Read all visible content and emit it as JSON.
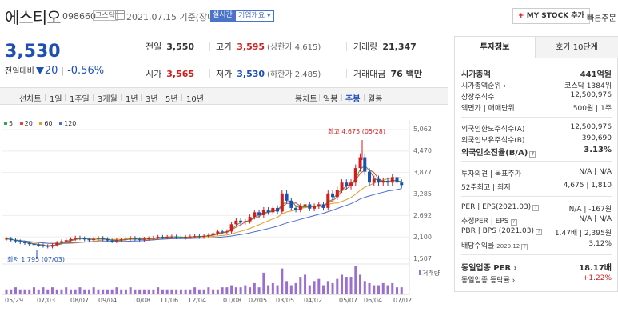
{
  "header": {
    "name": "에스티오",
    "code": "098660",
    "market": "코스닥",
    "date": "2021.07.15 기준(장마감)",
    "realtime": "실시간",
    "overview": "기업개요",
    "mystock": "MY STOCK 추가",
    "quick": "빠른주문"
  },
  "price": {
    "current": "3,530",
    "change_label": "전일대비",
    "change": "20",
    "change_pct": "-0.56%"
  },
  "quote": {
    "prev_label": "전일",
    "prev": "3,550",
    "high_label": "고가",
    "high": "3,595",
    "upper_limit": "(상한가 4,615)",
    "volume_label": "거래량",
    "volume": "21,347",
    "open_label": "시가",
    "open": "3,565",
    "low_label": "저가",
    "low": "3,530",
    "lower_limit": "(하한가 2,485)",
    "amount_label": "거래대금",
    "amount": "76 백만"
  },
  "tabs": {
    "line": "선차트",
    "d1": "1일",
    "w1": "1주일",
    "m3": "3개월",
    "y1": "1년",
    "y3": "3년",
    "y5": "5년",
    "y10": "10년",
    "candle": "봉차트",
    "daily": "일봉",
    "weekly": "주봉",
    "monthly": "월봉"
  },
  "legend": [
    {
      "label": "5",
      "color": "#2fa84a"
    },
    {
      "label": "20",
      "color": "#e8423a"
    },
    {
      "label": "60",
      "color": "#e39b2c"
    },
    {
      "label": "120",
      "color": "#4d6bd0"
    }
  ],
  "chart_data": {
    "type": "candlestick",
    "y_ticks": [
      "5,062",
      "4,470",
      "3,877",
      "3,285",
      "2,692",
      "2,100",
      "1,507"
    ],
    "ylim": [
      1507,
      5062
    ],
    "x_ticks": [
      "05/29",
      "07/03",
      "08/07",
      "09/04",
      "10/08",
      "11/06",
      "12/04",
      "01/08",
      "02/05",
      "03/05",
      "04/02",
      "05/07",
      "06/04",
      "07/02"
    ],
    "max_annotation": "최고 4,675 (05/28)",
    "min_annotation": "최저 1,795 (07/03)",
    "volume_label": "거래량",
    "weekly_closes": [
      2050,
      2010,
      1980,
      1950,
      1930,
      1900,
      1880,
      1870,
      1850,
      1830,
      1880,
      1940,
      1980,
      2010,
      2040,
      2080,
      2060,
      2030,
      2010,
      2050,
      2070,
      2040,
      2000,
      1980,
      2010,
      2030,
      2050,
      2070,
      2040,
      2020,
      2050,
      2060,
      2080,
      2100,
      2090,
      2100,
      2110,
      2090,
      2080,
      2100,
      2110,
      2120,
      2100,
      2130,
      2150,
      2200,
      2250,
      2230,
      2250,
      2450,
      2550,
      2500,
      2530,
      2650,
      2780,
      2700,
      2850,
      2780,
      2900,
      2800,
      3300,
      3100,
      2900,
      2850,
      2950,
      3000,
      2880,
      2950,
      3000,
      2900,
      3300,
      3200,
      3400,
      3600,
      3500,
      3600,
      4000,
      4300,
      3900,
      3600,
      3700,
      3600,
      3650,
      3600,
      3750,
      3600,
      3530
    ],
    "weekly_volumes": [
      2,
      2,
      3,
      2,
      2,
      2,
      3,
      2,
      3,
      2,
      3,
      2,
      2,
      3,
      2,
      2,
      3,
      2,
      2,
      3,
      2,
      2,
      2,
      2,
      3,
      2,
      2,
      3,
      2,
      2,
      2,
      2,
      2,
      3,
      2,
      2,
      2,
      2,
      2,
      2,
      2,
      3,
      2,
      2,
      3,
      2,
      2,
      3,
      3,
      4,
      3,
      3,
      4,
      3,
      5,
      3,
      10,
      4,
      5,
      4,
      12,
      6,
      4,
      5,
      8,
      9,
      4,
      6,
      7,
      4,
      6,
      5,
      7,
      9,
      8,
      8,
      13,
      9,
      6,
      5,
      4,
      4,
      5,
      4,
      5,
      3,
      3
    ]
  },
  "right_panel": {
    "tab_info": "투자정보",
    "tab_order": "호가 10단계",
    "market_cap_label": "시가총액",
    "market_cap": "441억원",
    "cap_rank_label": "시가총액순위",
    "cap_rank": "코스닥 1384위",
    "listed_label": "상장주식수",
    "listed": "12,500,976",
    "par_label": "액면가 | 매매단위",
    "par": "500원 | 1주",
    "foreign_limit_label": "외국인한도주식수(A)",
    "foreign_limit": "12,500,976",
    "foreign_hold_label": "외국인보유주식수(B)",
    "foreign_hold": "390,690",
    "foreign_ratio_label": "외국인소진율(B/A)",
    "foreign_ratio": "3.13%",
    "opinion_label": "투자의견 | 목표주가",
    "opinion": "N/A | N/A",
    "w52_label": "52주최고 | 최저",
    "w52": "4,675 | 1,810",
    "per_label": "PER | EPS(2021.03)",
    "per": "N/A | -167원",
    "est_per_label": "추정PER | EPS",
    "est_per": "N/A | N/A",
    "pbr_label": "PBR | BPS (2021.03)",
    "pbr": "1.47배 | 2,395원",
    "div_label": "배당수익률",
    "div_date": "2020.12",
    "div": "3.12%",
    "ind_per_label": "동일업종 PER",
    "ind_per": "18.17배",
    "ind_chg_label": "동일업종 등락률",
    "ind_chg": "+1.22%"
  }
}
